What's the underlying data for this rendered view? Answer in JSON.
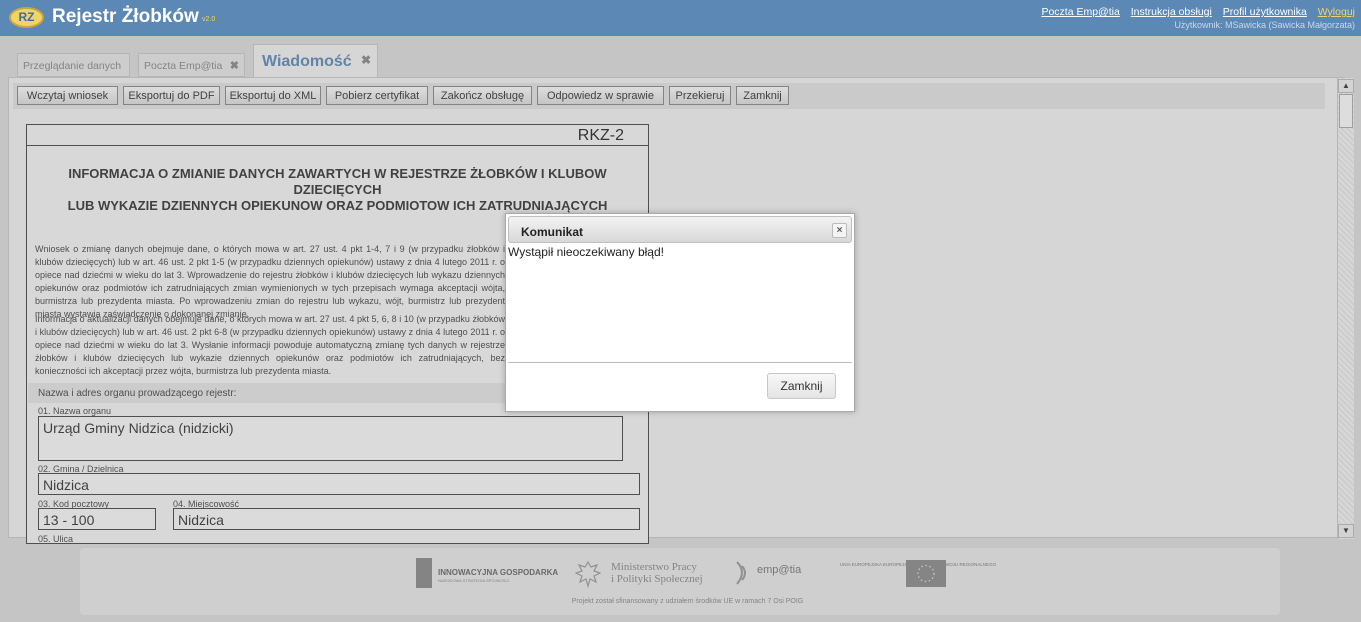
{
  "app": {
    "logo_text": "RZ",
    "title": "Rejestr Żłobków",
    "version": "v2.0"
  },
  "top_links": {
    "poczta": "Poczta Emp@tia",
    "instrukcja": "Instrukcja obsługi",
    "profil": "Profil użytkownika",
    "wyloguj": "Wyloguj",
    "user": "Użytkownik: MSawicka (Sawicka Małgorzata)"
  },
  "tabs": [
    {
      "label": "Przeglądanie danych"
    },
    {
      "label": "Poczta Emp@tia",
      "close": "✖"
    },
    {
      "label": "Wiadomość",
      "close": "✖"
    }
  ],
  "toolbar": {
    "buttons": [
      "Wczytaj wniosek",
      "Eksportuj do PDF",
      "Eksportuj do XML",
      "Pobierz certyfikat",
      "Zakończ obsługę",
      "Odpowiedz w sprawie",
      "Przekieruj",
      "Zamknij"
    ]
  },
  "form": {
    "code": "RKZ-2",
    "title_line1": "INFORMACJA O ZMIANIE DANYCH ZAWARTYCH W REJESTRZE ŻŁOBKÓW I KLUBOW DZIECIĘCYCH",
    "title_line2": "LUB WYKAZIE DZIENNYCH OPIEKUNOW ORAZ PODMIOTOW ICH ZATRUDNIAJĄCYCH",
    "paragraph1": "Wniosek o zmianę danych obejmuje dane, o których mowa w art. 27 ust. 4 pkt 1-4, 7 i 9 (w przypadku żłobków i klubów dziecięcych) lub w art. 46 ust. 2 pkt 1-5 (w przypadku dziennych opiekunów) ustawy z dnia 4 lutego 2011 r. o opiece nad dziećmi w wieku do lat 3. Wprowadzenie do rejestru żłobków i klubów dziecięcych lub wykazu dziennych opiekunów oraz podmiotów ich zatrudniających zmian wymienionych w tych przepisach wymaga akceptacji wójta, burmistrza lub prezydenta miasta. Po wprowadzeniu zmian do rejestru lub wykazu, wójt, burmistrz lub prezydent miasta wystawia zaświadczenie o dokonanej zmianie.",
    "paragraph2": "Informacja o aktualizacji danych obejmuje dane, o których mowa w art. 27 ust. 4 pkt 5, 6, 8 i 10 (w przypadku żłobków i klubów dziecięcych) lub w art. 46 ust. 2 pkt 6-8 (w przypadku dziennych opiekunów) ustawy z dnia 4 lutego 2011 r. o opiece nad dziećmi w wieku do lat 3. Wysłanie informacji powoduje automatyczną zmianę tych danych w rejestrze żłobków i klubów dziecięcych lub wykazie dziennych opiekunów oraz podmiotów ich zatrudniających, bez konieczności ich akceptacji przez wójta, burmistrza lub prezydenta miasta.",
    "section_label": "Nazwa i adres organu prowadzącego rejestr:",
    "f01_label": "01. Nazwa organu",
    "f01_value": "Urząd Gminy Nidzica (nidzicki)",
    "f02_label": "02. Gmina / Dzielnica",
    "f02_value": "Nidzica",
    "f03_label": "03. Kod pocztowy",
    "f03_value": "13 - 100",
    "f04_label": "04. Miejscowość",
    "f04_value": "Nidzica",
    "f05_label": "05. Ulica"
  },
  "dialog": {
    "title": "Komunikat",
    "close": "×",
    "message": "Wystąpił nieoczekiwany błąd!",
    "button": "Zamknij"
  },
  "footer": {
    "logo1": "INNOWACYJNA GOSPODARKA",
    "logo1_sub": "NARODOWA STRATEGIA SPÓJNOŚCI",
    "logo2_line1": "Ministerstwo Pracy",
    "logo2_line2": "i Polityki Społecznej",
    "logo3": "emp@tia",
    "logo4": "UNIA EUROPEJSKA EUROPEJSKI FUNDUSZ ROZWOJU REGIONALNEGO",
    "note": "Projekt został sfinansowany z udziałem środków UE w ramach 7 Osi POIG"
  },
  "colors": {
    "header": "#5b88b5",
    "accent": "#f0d46a"
  }
}
